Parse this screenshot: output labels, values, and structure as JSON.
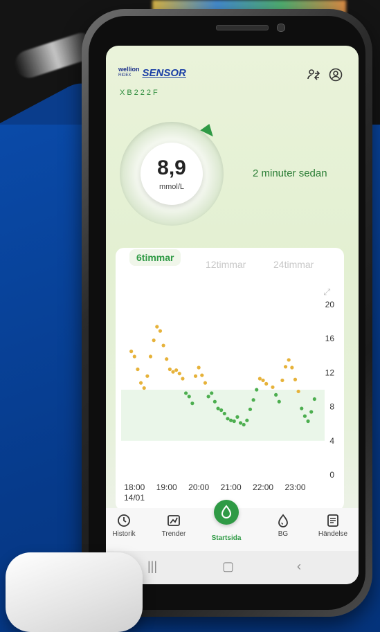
{
  "app": {
    "brand_prefix": "wellion",
    "brand_sub": "RIDEX",
    "brand_name": "SENSOR",
    "serial": "XB222F"
  },
  "gauge": {
    "value": "8,9",
    "unit": "mmol/L",
    "trend": "rising",
    "time_ago": "2 minuter sedan"
  },
  "chart_tabs": [
    "6timmar",
    "12timmar",
    "24timmar"
  ],
  "active_tab": "6timmar",
  "chart_data": {
    "type": "scatter",
    "title": "",
    "xlabel": "",
    "ylabel": "",
    "x_ticks": [
      "18:00",
      "19:00",
      "20:00",
      "21:00",
      "22:00",
      "23:00"
    ],
    "y_ticks": [
      0,
      4,
      8,
      12,
      16,
      20
    ],
    "date_label": "14/01",
    "ylim": [
      0,
      20
    ],
    "target_range": [
      4,
      10
    ],
    "series": [
      {
        "color": "#e6b23a",
        "values": [
          [
            17.9,
            14.5
          ],
          [
            18.0,
            13.9
          ],
          [
            18.1,
            12.4
          ],
          [
            18.2,
            10.8
          ],
          [
            18.3,
            10.2
          ],
          [
            18.4,
            11.6
          ],
          [
            18.5,
            13.9
          ],
          [
            18.6,
            15.8
          ],
          [
            18.7,
            17.4
          ],
          [
            18.8,
            16.9
          ],
          [
            18.9,
            15.2
          ],
          [
            19.0,
            13.6
          ],
          [
            19.1,
            12.4
          ],
          [
            19.2,
            12.1
          ],
          [
            19.3,
            12.3
          ],
          [
            19.4,
            11.9
          ],
          [
            19.5,
            11.3
          ],
          [
            19.9,
            11.6
          ],
          [
            20.0,
            12.6
          ],
          [
            20.1,
            11.7
          ],
          [
            20.2,
            10.8
          ],
          [
            21.9,
            11.3
          ],
          [
            22.0,
            11.1
          ],
          [
            22.1,
            10.7
          ],
          [
            22.3,
            10.3
          ],
          [
            22.6,
            11.1
          ],
          [
            22.7,
            12.7
          ],
          [
            22.8,
            13.5
          ],
          [
            22.9,
            12.6
          ],
          [
            23.0,
            11.2
          ],
          [
            23.1,
            9.8
          ]
        ]
      },
      {
        "color": "#4cae4f",
        "values": [
          [
            19.6,
            9.6
          ],
          [
            19.7,
            9.2
          ],
          [
            19.8,
            8.4
          ],
          [
            20.3,
            9.2
          ],
          [
            20.4,
            9.6
          ],
          [
            20.5,
            8.6
          ],
          [
            20.6,
            7.8
          ],
          [
            20.7,
            7.6
          ],
          [
            20.8,
            7.2
          ],
          [
            20.9,
            6.6
          ],
          [
            21.0,
            6.4
          ],
          [
            21.1,
            6.3
          ],
          [
            21.2,
            6.8
          ],
          [
            21.3,
            6.1
          ],
          [
            21.4,
            5.9
          ],
          [
            21.5,
            6.4
          ],
          [
            21.6,
            7.7
          ],
          [
            21.7,
            8.8
          ],
          [
            21.8,
            10.0
          ],
          [
            22.4,
            9.4
          ],
          [
            22.5,
            8.6
          ],
          [
            23.2,
            7.8
          ],
          [
            23.3,
            6.9
          ],
          [
            23.4,
            6.3
          ],
          [
            23.5,
            7.4
          ],
          [
            23.6,
            8.9
          ]
        ]
      }
    ]
  },
  "nav": {
    "items": [
      "Historik",
      "Trender",
      "Startsida",
      "BG",
      "Händelse"
    ],
    "active": "Startsida"
  },
  "icons": {
    "header_left": "people-switch-icon",
    "header_right": "profile-icon",
    "expand": "expand-arrows-icon",
    "history": "clock-icon",
    "trends": "trend-chart-icon",
    "home": "home-drop-icon",
    "bg": "blood-drop-icon",
    "events": "document-icon"
  },
  "colors": {
    "accent": "#2f9a45",
    "high": "#e6b23a",
    "target_band": "#eaf6e9"
  }
}
